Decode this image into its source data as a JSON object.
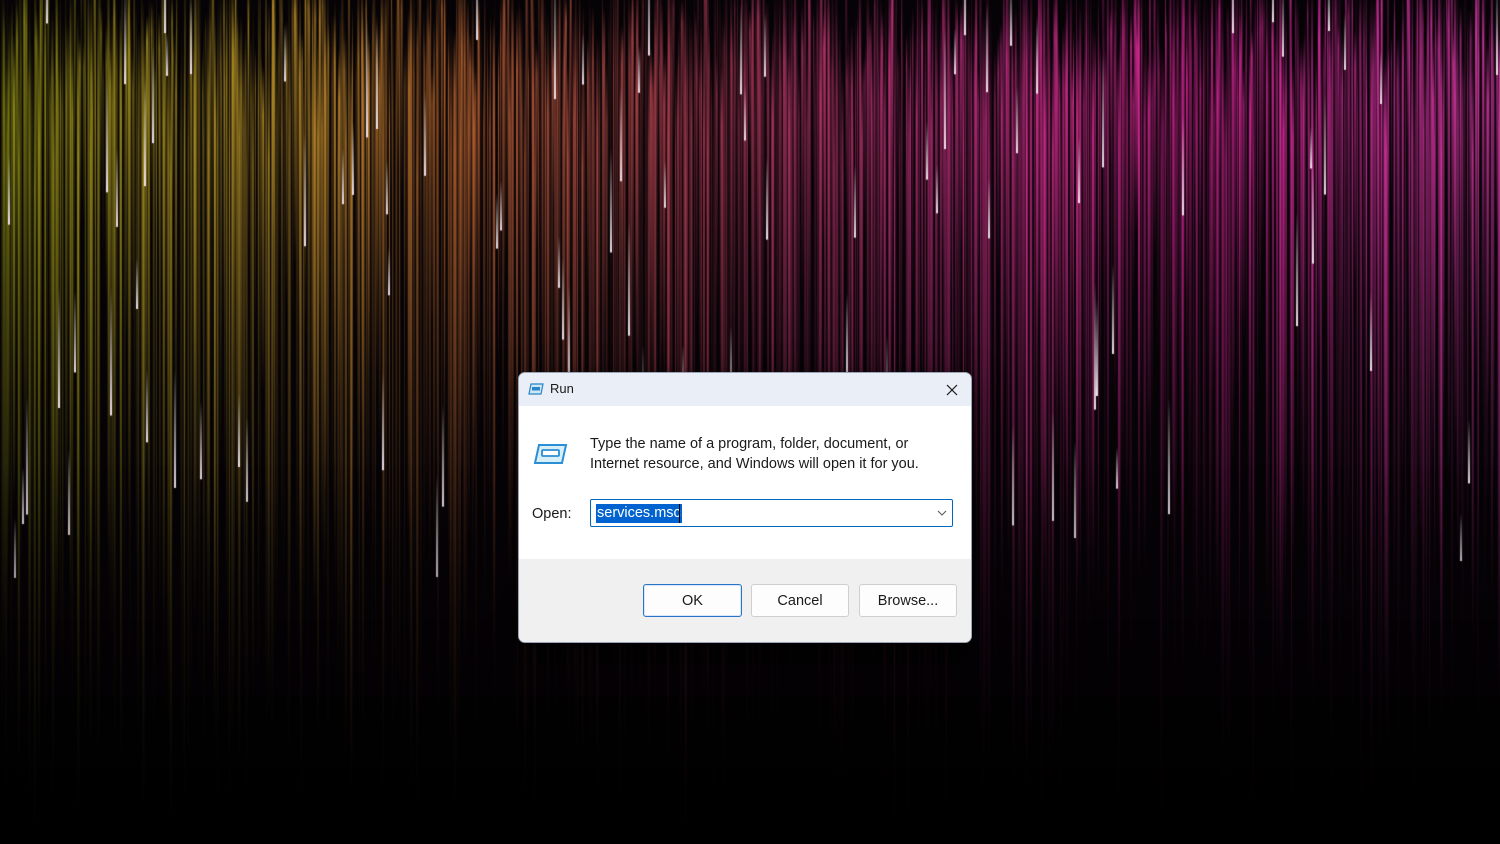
{
  "window": {
    "title": "Run",
    "icon": "run-app-icon",
    "close_icon": "close-icon"
  },
  "content": {
    "icon": "run-app-icon",
    "description_line1": "Type the name of a program, folder, document, or",
    "description_line2": "Internet resource, and Windows will open it for you.",
    "open_label": "Open:",
    "open_value": "services.msc",
    "dropdown_icon": "chevron-down-icon"
  },
  "buttons": {
    "ok": "OK",
    "cancel": "Cancel",
    "browse": "Browse..."
  },
  "colors": {
    "selection": "#0063cf",
    "focus_border": "#0067c0",
    "titlebar": "#e9eef7",
    "footer": "#f1f0f1"
  }
}
